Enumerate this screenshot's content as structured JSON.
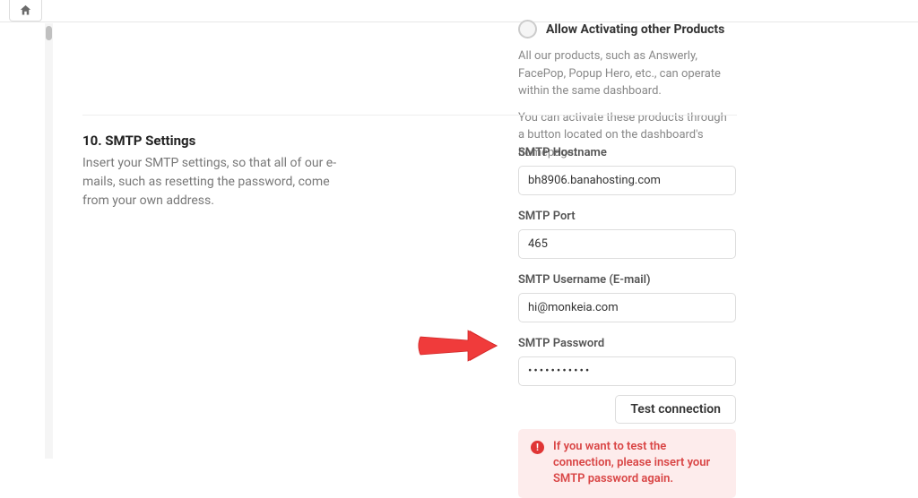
{
  "allowSection": {
    "toggle_label": "Allow Activating other Products",
    "desc1": "All our products, such as Answerly, FacePop, Popup Hero, etc., can operate within the same dashboard.",
    "desc2": "You can activate these products through a button located on the dashboard's homepage."
  },
  "smtp": {
    "title": "10. SMTP Settings",
    "desc": "Insert your SMTP settings, so that all of our e-mails, such as resetting the password, come from your own address.",
    "hostname_label": "SMTP Hostname",
    "hostname_value": "bh8906.banahosting.com",
    "port_label": "SMTP Port",
    "port_value": "465",
    "username_label": "SMTP Username (E-mail)",
    "username_value": "hi@monkeia.com",
    "password_label": "SMTP Password",
    "password_value": "•••••••••••",
    "test_btn": "Test connection",
    "alert_text": "If you want to test the connection, please insert your SMTP password again."
  }
}
